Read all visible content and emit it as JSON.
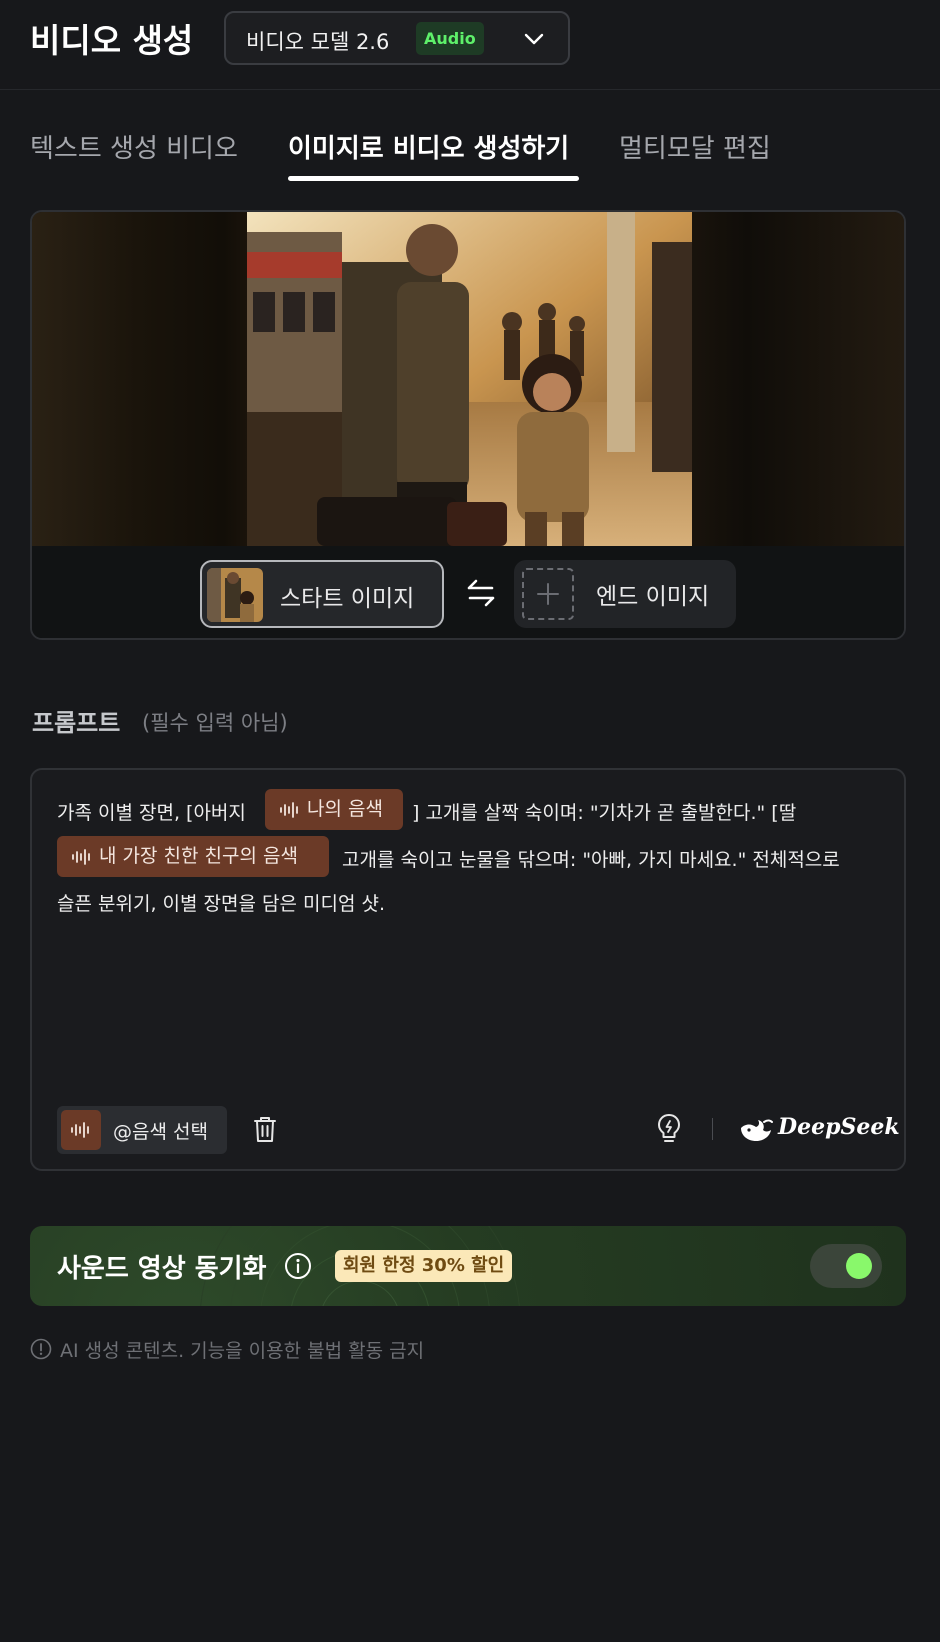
{
  "header": {
    "title": "비디오 생성",
    "model_select": {
      "label": "비디오 모델 2.6",
      "badge": "Audio"
    }
  },
  "tabs": [
    {
      "label": "텍스트 생성 비디오",
      "active": false
    },
    {
      "label": "이미지로 비디오 생성하기",
      "active": true
    },
    {
      "label": "멀티모달 편집",
      "active": false
    }
  ],
  "image_panel": {
    "start_label": "스타트 이미지",
    "end_label": "엔드 이미지"
  },
  "prompt": {
    "heading": "프롬프트",
    "optional_note": "(필수 입력 아님)",
    "line1_a": "가족 이별 장면, [아버지",
    "chip1": "나의 음색",
    "line1_b": "] 고개를 살짝 숙이며: \"기차가 곧 출발한다.\" [딸",
    "chip2": "내 가장 친한 친구의 음색",
    "line2_b": "고개를 숙이고 눈물을 닦으며: \"아빠, 가지 마세요.\" 전체적으로",
    "line3": "슬픈 분위기, 이별 장면을 담은 미디엄 샷.",
    "select_voice_label": "@음색 선택",
    "provider": "DeepSeek"
  },
  "sound_sync": {
    "title": "사운드 영상 동기화",
    "badge": "회원 한정 30% 할인",
    "enabled": true
  },
  "disclaimer": "AI 생성 콘텐츠. 기능을 이용한 불법 활동 금지",
  "colors": {
    "background": "#17181b",
    "accent_green": "#89f86b",
    "voice_chip": "#6b3a27",
    "audio_badge_text": "#5ef06a"
  }
}
